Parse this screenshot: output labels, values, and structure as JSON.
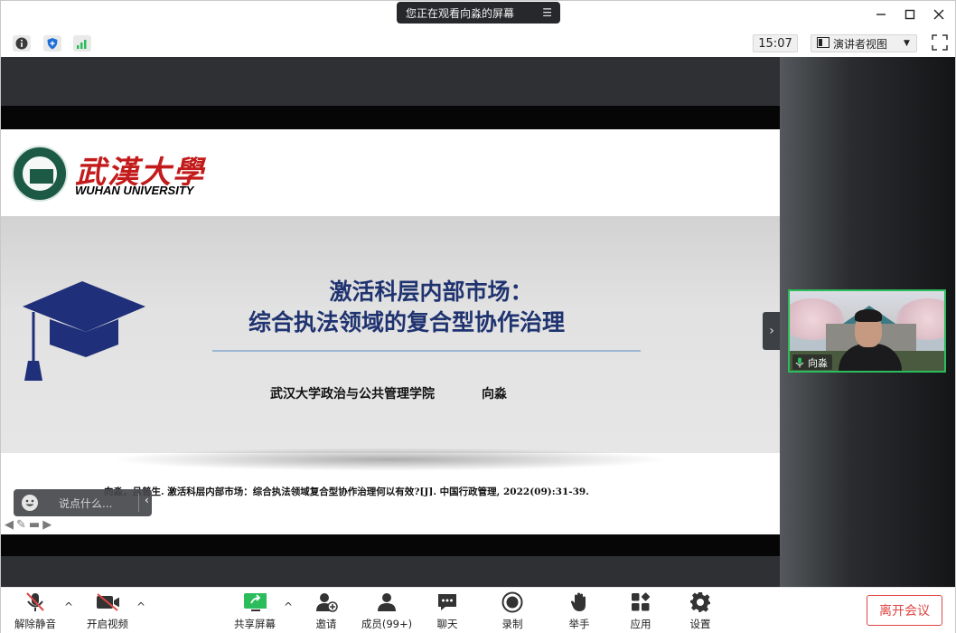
{
  "titlebar": {
    "viewing_banner": "您正在观看向淼的屏幕",
    "menu_icon": "list-icon",
    "controls": [
      "minimize-icon",
      "maximize-icon",
      "close-icon"
    ]
  },
  "infobar": {
    "clock": "15:07",
    "view_mode": "演讲者视图",
    "icons": [
      "info-icon",
      "shield-icon",
      "signal-icon",
      "fullscreen-icon"
    ]
  },
  "slide": {
    "university_cn": "武漢大學",
    "university_en": "WUHAN UNIVERSITY",
    "title_line1": "激活科层内部市场：",
    "title_line2": "综合执法领域的复合型协作治理",
    "affiliation": "武汉大学政治与公共管理学院",
    "author": "向淼",
    "citation": "向淼，吕普生. 激活科层内部市场：综合执法领域复合型协作治理何以有效?[J]. 中国行政管理, 2022(09):31-39.",
    "title_color": "#1f3370",
    "logo_color": "#c31b1b"
  },
  "chat": {
    "placeholder": "说点什么..."
  },
  "participant": {
    "name": "向淼",
    "highlight_color": "#2bbd5c"
  },
  "toolbar": {
    "unmute": "解除静音",
    "start_video": "开启视频",
    "share_screen": "共享屏幕",
    "invite": "邀请",
    "members": "成员(99+)",
    "chat": "聊天",
    "record": "录制",
    "raise_hand": "举手",
    "apps": "应用",
    "settings": "设置",
    "leave": "离开会议",
    "leave_color": "#e04545"
  }
}
